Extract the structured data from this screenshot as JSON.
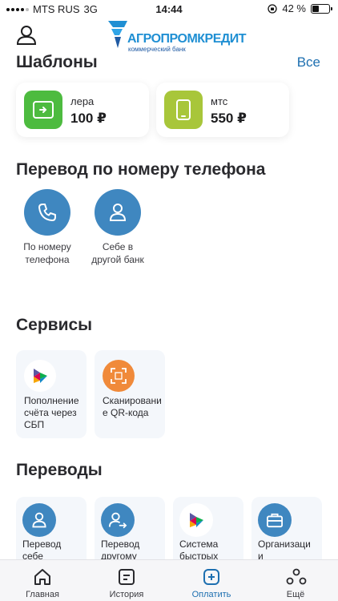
{
  "status": {
    "carrier": "MTS RUS",
    "network": "3G",
    "time": "14:44",
    "battery": "42 %",
    "battery_fraction": 0.42
  },
  "header": {
    "logo_text": "АГРОПРОМКРЕДИТ",
    "logo_sub": "коммерческий банк"
  },
  "templates": {
    "title": "Шаблоны",
    "all_link": "Все",
    "items": [
      {
        "name": "лера",
        "amount": "100 ₽",
        "icon": "card-transfer-icon",
        "color": "#4dbb3f"
      },
      {
        "name": "мтс",
        "amount": "550 ₽",
        "icon": "phone-icon",
        "color": "#a8c63a"
      }
    ]
  },
  "phone_transfer": {
    "title": "Перевод по номеру телефона",
    "items": [
      {
        "line1": "По номеру",
        "line2": "телефона",
        "icon": "phone-handset-icon"
      },
      {
        "line1": "Себе в",
        "line2": "другой банк",
        "icon": "person-icon"
      }
    ]
  },
  "services": {
    "title": "Сервисы",
    "items": [
      {
        "label": "Пополнение счёта через СБП",
        "icon": "sbp-icon"
      },
      {
        "label": "Сканирование QR-кода",
        "icon": "qr-scan-icon",
        "color": "#f08a3a"
      }
    ]
  },
  "transfers": {
    "title": "Переводы",
    "items": [
      {
        "line1": "Перевод",
        "line2": "себе",
        "icon": "person-icon"
      },
      {
        "line1": "Перевод",
        "line2": "другому",
        "icon": "person-arrow-icon"
      },
      {
        "line1": "Система",
        "line2": "быстрых",
        "icon": "sbp-icon"
      },
      {
        "line1": "Организаци",
        "line2": "и",
        "icon": "briefcase-icon"
      }
    ]
  },
  "tabs": [
    {
      "label": "Главная",
      "icon": "home-icon"
    },
    {
      "label": "История",
      "icon": "history-icon"
    },
    {
      "label": "Оплатить",
      "icon": "pay-plus-icon",
      "active": true
    },
    {
      "label": "Ещё",
      "icon": "more-icon"
    }
  ],
  "colors": {
    "accent": "#1d6fb0",
    "circle": "#3f87c0",
    "card_bg": "#f4f7fb"
  }
}
